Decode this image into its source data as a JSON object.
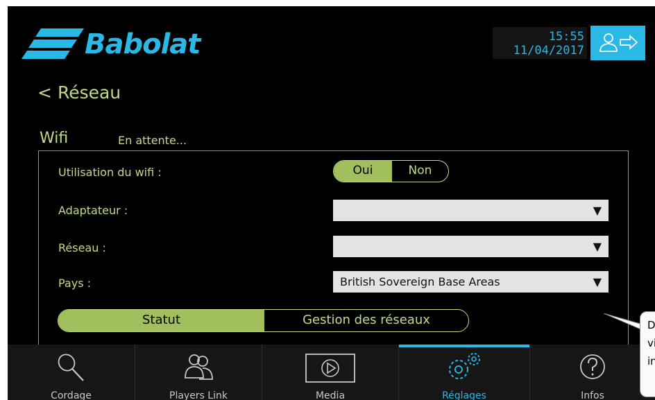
{
  "header": {
    "brand": "Babolat",
    "time": "15:55",
    "date": "11/04/2017",
    "logout_icon": "user-logout-icon"
  },
  "page": {
    "back_label": "Réseau",
    "section_title": "Wifi",
    "section_status": "En attente..."
  },
  "form": {
    "wifi_usage_label": "Utilisation du wifi :",
    "toggle_on": "Oui",
    "toggle_off": "Non",
    "adapter_label": "Adaptateur :",
    "adapter_value": "",
    "network_label": "Réseau :",
    "network_value": "",
    "country_label": "Pays :",
    "country_value": "British Sovereign Base Areas"
  },
  "tabs": {
    "status": "Statut",
    "manage": "Gestion des réseaux"
  },
  "navbar": {
    "items": [
      {
        "label": "Cordage",
        "icon": "racquet-icon"
      },
      {
        "label": "Players Link",
        "icon": "players-icon"
      },
      {
        "label": "Media",
        "icon": "play-icon"
      },
      {
        "label": "Réglages",
        "icon": "gears-icon"
      },
      {
        "label": "Infos",
        "icon": "help-icon"
      }
    ],
    "active_index": 3
  },
  "tooltip": {
    "line1": "D",
    "line2": "vi",
    "line3": "in"
  },
  "colors": {
    "accent_blue": "#2ab8e6",
    "accent_green": "#a1bf5c",
    "text_green": "#c3dc84",
    "background": "#000000"
  }
}
